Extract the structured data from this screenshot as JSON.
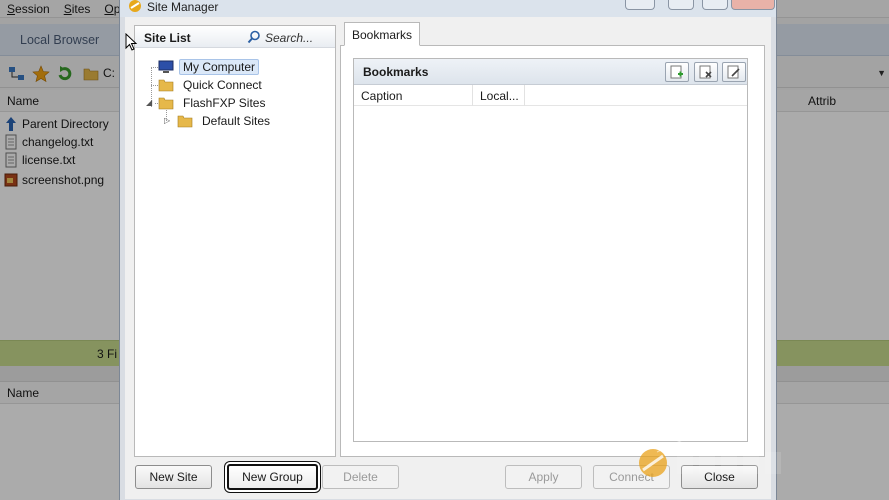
{
  "app": {
    "menu": [
      "Session",
      "Sites",
      "Op"
    ],
    "local_tab_label": "Local Browser",
    "path": "C:",
    "columns": {
      "name": "Name",
      "attrib": "Attrib"
    },
    "files": [
      {
        "name": "Parent Directory",
        "icon": "parent-directory-icon"
      },
      {
        "name": "changelog.txt",
        "icon": "text-file-icon"
      },
      {
        "name": "license.txt",
        "icon": "text-file-icon"
      },
      {
        "name": "screenshot.png",
        "icon": "image-file-icon"
      }
    ],
    "status_text": "3 Fi",
    "queue_columns": {
      "name": "Name"
    },
    "colors": {
      "status_bar": "#c8dc8e",
      "tab_strip": "#dfe8f4"
    }
  },
  "dialog": {
    "title": "Site Manager",
    "site_list": {
      "title": "Site List",
      "search_placeholder": "Search...",
      "nodes": [
        {
          "label": "My Computer",
          "icon": "computer-icon",
          "selected": true
        },
        {
          "label": "Quick Connect",
          "icon": "folder-icon"
        },
        {
          "label": "FlashFXP Sites",
          "icon": "folder-icon",
          "expanded": true
        },
        {
          "label": "Default Sites",
          "icon": "folder-icon",
          "collapsed": true
        }
      ]
    },
    "tabs": {
      "bookmarks": "Bookmarks"
    },
    "bookmarks": {
      "title": "Bookmarks",
      "columns": [
        "Caption",
        "Local..."
      ],
      "tools": [
        "add-bookmark-icon",
        "delete-bookmark-icon",
        "edit-bookmark-icon"
      ]
    },
    "buttons": {
      "new_site": "New Site",
      "new_group": "New Group",
      "delete": "Delete",
      "apply": "Apply",
      "connect": "Connect",
      "close": "Close"
    }
  }
}
